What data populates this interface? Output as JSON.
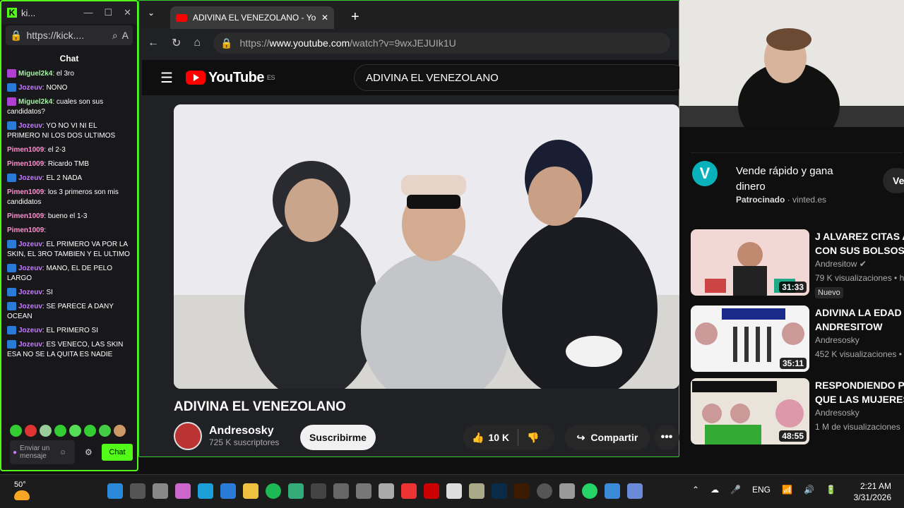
{
  "kick": {
    "tab_title": "ki...",
    "url": "https://kick....",
    "chat_header": "Chat",
    "messages": [
      {
        "user": "Miguel2k4",
        "text": ": el 3ro",
        "color": "#a6f0a6"
      },
      {
        "user": "Jozeuv",
        "text": ": NONO",
        "color": "#c57bff"
      },
      {
        "user": "Miguel2k4",
        "text": ": cuales son sus candidatos?",
        "color": "#a6f0a6"
      },
      {
        "user": "Jozeuv",
        "text": ": YO NO VI NI EL PRIMERO NI LOS DOS ULTIMOS",
        "color": "#c57bff"
      },
      {
        "user": "Pimen1009",
        "text": ": el 2-3",
        "color": "#ff8fd1"
      },
      {
        "user": "Pimen1009",
        "text": ": Ricardo TMB",
        "color": "#ff8fd1"
      },
      {
        "user": "Jozeuv",
        "text": ": EL 2 NADA",
        "color": "#c57bff"
      },
      {
        "user": "Pimen1009",
        "text": ": los 3 primeros son mis candidatos",
        "color": "#ff8fd1"
      },
      {
        "user": "Pimen1009",
        "text": ": bueno el 1-3",
        "color": "#ff8fd1"
      },
      {
        "user": "Pimen1009",
        "text": ":",
        "color": "#ff8fd1"
      },
      {
        "user": "Jozeuv",
        "text": ": EL PRIMERO VA POR LA SKIN, EL 3RO TAMBIEN Y EL ULTIMO",
        "color": "#c57bff"
      },
      {
        "user": "Jozeuv",
        "text": ": MANO, EL DE PELO LARGO",
        "color": "#c57bff"
      },
      {
        "user": "Jozeuv",
        "text": ": SI",
        "color": "#c57bff"
      },
      {
        "user": "Jozeuv",
        "text": ": SE PARECE A DANY OCEAN",
        "color": "#c57bff"
      },
      {
        "user": "Jozeuv",
        "text": ": EL PRIMERO SI",
        "color": "#c57bff"
      },
      {
        "user": "Jozeuv",
        "text": ": ES VENECO, LAS SKIN ESA NO SE LA QUITA ES NADIE",
        "color": "#c57bff"
      }
    ],
    "input_placeholder": "Enviar un mensaje",
    "chat_button": "Chat"
  },
  "browser": {
    "tab_title": "ADIVINA EL VENEZOLANO - YouTu",
    "url_prefix": "https://",
    "url_host": "www.youtube.com",
    "url_path": "/watch?v=9wxJEJUIk1U",
    "logo_text": "YouTube",
    "logo_region": "ES",
    "search_query": "ADIVINA EL VENEZOLANO",
    "video_title": "ADIVINA EL VENEZOLANO",
    "channel_name": "Andresosky",
    "subscribers": "725 K suscriptores",
    "subscribe_label": "Suscribirme",
    "likes": "10 K",
    "share_label": "Compartir"
  },
  "sidebar": {
    "ad_title": "Vende rápido y gana dinero",
    "ad_sponsor_label": "Patrocinado",
    "ad_domain": "vinted.es",
    "ad_button": "Ve",
    "recs": [
      {
        "title1": "J ALVAREZ CITAS A",
        "title2": "CON SUS BOLSOS",
        "channel": "Andresitow",
        "views": "79 K visualizaciones • h",
        "duration": "31:33",
        "badge": "Nuevo"
      },
      {
        "title1": "ADIVINA LA EDAD -",
        "title2": "ANDRESITOW",
        "channel": "Andresosky",
        "views": "452 K visualizaciones •",
        "duration": "35:11",
        "badge": ""
      },
      {
        "title1": "RESPONDIENDO PR",
        "title2": "QUE LAS MUJERES",
        "channel": "Andresosky",
        "views": "1 M de visualizaciones",
        "duration": "48:55",
        "badge": ""
      }
    ]
  },
  "taskbar": {
    "temperature": "50°",
    "language": "ENG",
    "time": "2:21 AM",
    "date": "3/31/2026"
  }
}
